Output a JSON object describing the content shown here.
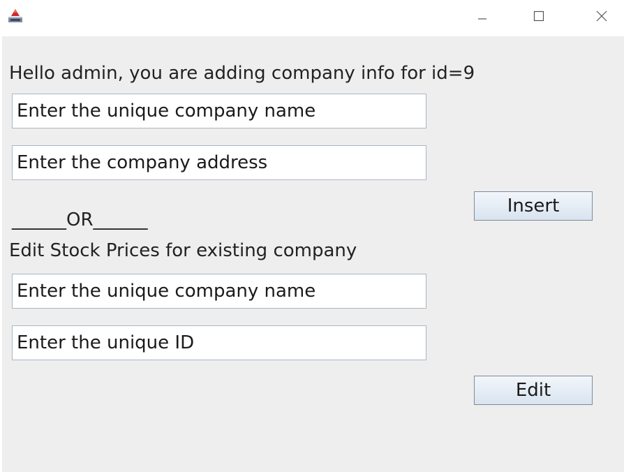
{
  "titlebar": {
    "app_icon": "java-app-icon",
    "minimize_icon": "minimize-icon",
    "maximize_icon": "maximize-icon",
    "close_icon": "close-icon"
  },
  "form": {
    "greeting": "Hello admin, you are adding company info for id=9",
    "insert": {
      "company_name_value": "Enter the unique company name",
      "company_address_value": "Enter the company address",
      "button_label": "Insert"
    },
    "separator": "______OR______",
    "edit": {
      "heading": "Edit Stock Prices for existing company",
      "company_name_value": "Enter the unique company name",
      "id_value": "Enter the unique ID",
      "button_label": "Edit"
    }
  },
  "colors": {
    "panel_background": "#eeeeee",
    "field_border": "#a9b6c4",
    "button_border": "#7a8a9c"
  }
}
